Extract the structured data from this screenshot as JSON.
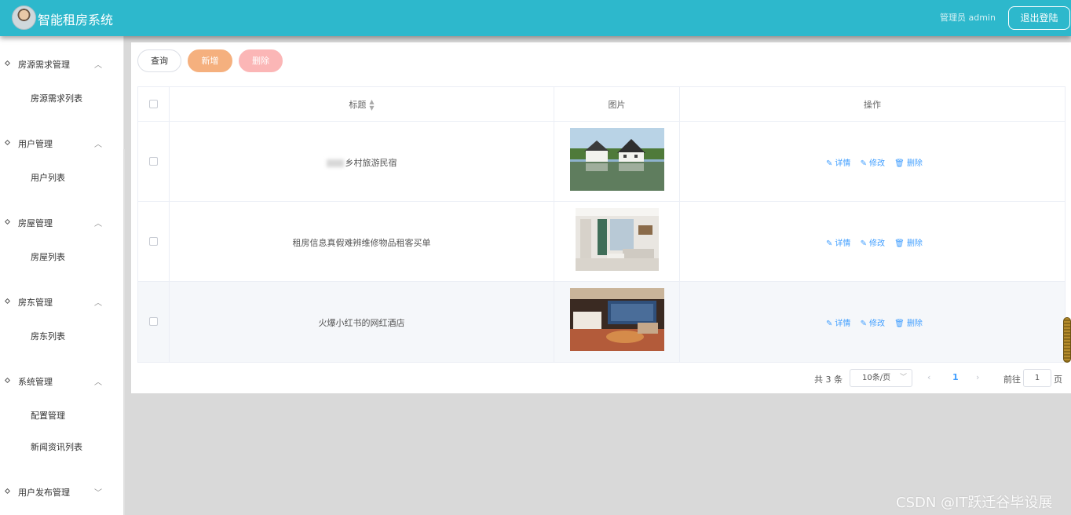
{
  "header": {
    "title": "智能租房系统",
    "user_label": "管理员 admin",
    "logout_label": "退出登陆",
    "brand_color": "#2db8cc"
  },
  "sidebar": {
    "groups": [
      {
        "label": "房源需求管理",
        "chevron": "chevron-up-icon",
        "items": [
          "房源需求列表"
        ]
      },
      {
        "label": "用户管理",
        "chevron": "chevron-up-icon",
        "items": [
          "用户列表"
        ]
      },
      {
        "label": "房屋管理",
        "chevron": "chevron-up-icon",
        "items": [
          "房屋列表"
        ]
      },
      {
        "label": "房东管理",
        "chevron": "chevron-up-icon",
        "items": [
          "房东列表"
        ]
      },
      {
        "label": "系统管理",
        "chevron": "chevron-up-icon",
        "items": [
          "配置管理",
          "新闻资讯列表"
        ]
      },
      {
        "label": "用户发布管理",
        "chevron": "chevron-down-icon",
        "items": []
      }
    ]
  },
  "toolbar": {
    "query_label": "查询",
    "add_label": "新增",
    "delete_label": "删除",
    "add_color": "#f5b07e",
    "delete_color": "#fbb6b6"
  },
  "table": {
    "columns": [
      "标题",
      "图片",
      "操作"
    ],
    "rows": [
      {
        "title": "乡村旅游民宿",
        "image": "village-homestay-photo",
        "selected": false
      },
      {
        "title": "租房信息真假难辨维修物品租客买单",
        "image": "living-room-photo",
        "selected": false
      },
      {
        "title": "火爆小红书的网红酒店",
        "image": "hotel-room-photo",
        "selected": false
      }
    ],
    "actions": [
      "详情",
      "修改",
      "删除"
    ],
    "action_color": "#409eff"
  },
  "pagination": {
    "total_text": "共 3 条",
    "page_size": "10条/页",
    "current_page": "1",
    "goto_label": "前往",
    "goto_value": "1",
    "goto_suffix": "页"
  },
  "watermark": "CSDN @IT跃迁谷毕设展"
}
